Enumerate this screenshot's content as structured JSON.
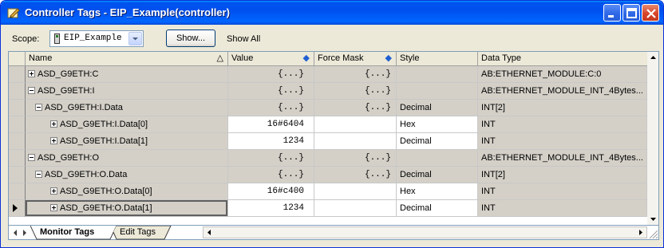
{
  "window": {
    "title": "Controller Tags - EIP_Example(controller)"
  },
  "toolbar": {
    "scope_label": "Scope:",
    "scope_value": "EIP_Example",
    "show_button": "Show...",
    "show_all": "Show All"
  },
  "columns": {
    "name": "Name",
    "value": "Value",
    "force_mask": "Force Mask",
    "style": "Style",
    "data_type": "Data Type"
  },
  "rows": [
    {
      "name": "ASD_G9ETH:C",
      "value": "{...}",
      "force_mask": "{...}",
      "style": "",
      "data_type": "AB:ETHERNET_MODULE:C:0"
    },
    {
      "name": "ASD_G9ETH:I",
      "value": "{...}",
      "force_mask": "{...}",
      "style": "",
      "data_type": "AB:ETHERNET_MODULE_INT_4Bytes..."
    },
    {
      "name": "ASD_G9ETH:I.Data",
      "value": "{...}",
      "force_mask": "{...}",
      "style": "Decimal",
      "data_type": "INT[2]"
    },
    {
      "name": "ASD_G9ETH:I.Data[0]",
      "value": "16#6404",
      "force_mask": "",
      "style": "Hex",
      "data_type": "INT"
    },
    {
      "name": "ASD_G9ETH:I.Data[1]",
      "value": "1234",
      "force_mask": "",
      "style": "Decimal",
      "data_type": "INT"
    },
    {
      "name": "ASD_G9ETH:O",
      "value": "{...}",
      "force_mask": "{...}",
      "style": "",
      "data_type": "AB:ETHERNET_MODULE_INT_4Bytes..."
    },
    {
      "name": "ASD_G9ETH:O.Data",
      "value": "{...}",
      "force_mask": "{...}",
      "style": "Decimal",
      "data_type": "INT[2]"
    },
    {
      "name": "ASD_G9ETH:O.Data[0]",
      "value": "16#c400",
      "force_mask": "",
      "style": "Hex",
      "data_type": "INT"
    },
    {
      "name": "ASD_G9ETH:O.Data[1]",
      "value": "1234",
      "force_mask": "",
      "style": "Decimal",
      "data_type": "INT"
    }
  ],
  "tabs": {
    "monitor": "Monitor Tags",
    "edit": "Edit Tags"
  },
  "colors": {
    "titlebar": "#0053ee",
    "readonly_cell": "#d4d0c8",
    "editable_cell": "#ffffff"
  }
}
